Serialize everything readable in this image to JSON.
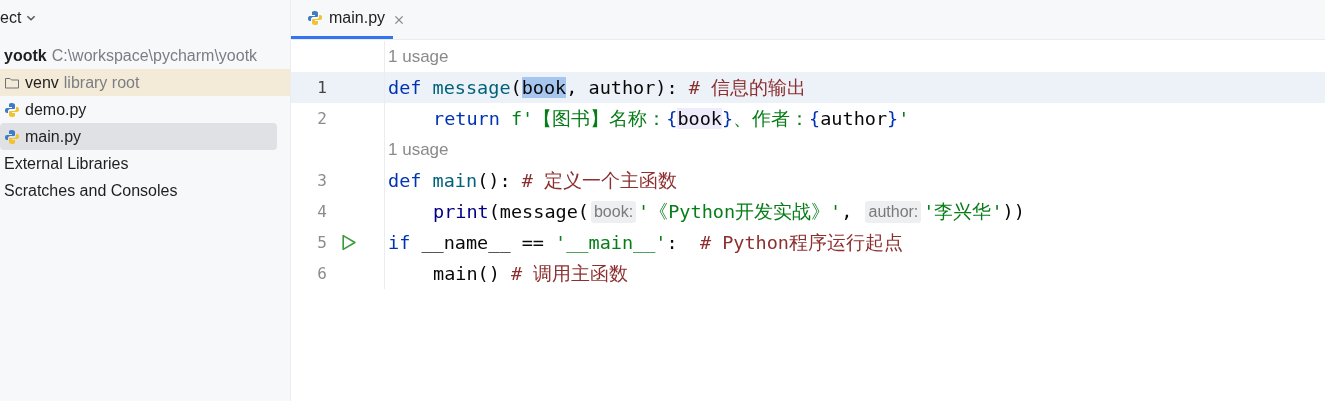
{
  "project_header": {
    "label": "ect"
  },
  "tabs": [
    {
      "label": "main.py",
      "selected": true
    }
  ],
  "project_tree": [
    {
      "label": "yootk",
      "detail": "C:\\workspace\\pycharm\\yootk",
      "kind": "module",
      "selected": false,
      "children": [
        {
          "label": "venv",
          "detail": "library root",
          "kind": "folder",
          "selected": false
        },
        {
          "label": "demo.py",
          "kind": "python",
          "selected": false
        },
        {
          "label": "main.py",
          "kind": "python",
          "selected": true
        }
      ]
    },
    {
      "label": "External Libraries",
      "kind": "plain",
      "selected": false
    },
    {
      "label": "Scratches and Consoles",
      "kind": "plain",
      "selected": false
    }
  ],
  "editor": {
    "lines": [
      {
        "kind": "usage",
        "text": "1 usage"
      },
      {
        "kind": "code",
        "number": "1",
        "current": true,
        "tokens": [
          {
            "kind": "keyword",
            "text": "def "
          },
          {
            "kind": "function",
            "text": "message"
          },
          {
            "kind": "plain",
            "text": "("
          },
          {
            "kind": "selection",
            "text": "book"
          },
          {
            "kind": "plain",
            "text": ", author): "
          },
          {
            "kind": "comment",
            "text": "# 信息的输出"
          }
        ]
      },
      {
        "kind": "code",
        "number": "2",
        "current": false,
        "indented": true,
        "tokens": [
          {
            "kind": "keyword",
            "text": "return "
          },
          {
            "kind": "string",
            "text": "f'【图书】名称："
          },
          {
            "kind": "keyword",
            "text": "{"
          },
          {
            "kind": "reference",
            "text": "book"
          },
          {
            "kind": "keyword",
            "text": "}"
          },
          {
            "kind": "string",
            "text": "、作者："
          },
          {
            "kind": "keyword",
            "text": "{"
          },
          {
            "kind": "plain",
            "text": "author"
          },
          {
            "kind": "keyword",
            "text": "}"
          },
          {
            "kind": "string",
            "text": "'"
          }
        ]
      },
      {
        "kind": "usage",
        "text": "1 usage"
      },
      {
        "kind": "code",
        "number": "3",
        "current": false,
        "tokens": [
          {
            "kind": "keyword",
            "text": "def "
          },
          {
            "kind": "function",
            "text": "main"
          },
          {
            "kind": "plain",
            "text": "(): "
          },
          {
            "kind": "comment",
            "text": "# 定义一个主函数"
          }
        ]
      },
      {
        "kind": "code",
        "number": "4",
        "current": false,
        "indented": true,
        "tokens": [
          {
            "kind": "builtin",
            "text": "print"
          },
          {
            "kind": "plain",
            "text": "(message("
          },
          {
            "kind": "hint",
            "text": "book:"
          },
          {
            "kind": "string",
            "text": "'《Python开发实战》'"
          },
          {
            "kind": "plain",
            "text": ", "
          },
          {
            "kind": "hint",
            "text": "author:"
          },
          {
            "kind": "string",
            "text": "'李兴华'"
          },
          {
            "kind": "plain",
            "text": "))"
          }
        ]
      },
      {
        "kind": "code",
        "number": "5",
        "current": false,
        "runnable": true,
        "tokens": [
          {
            "kind": "keyword",
            "text": "if "
          },
          {
            "kind": "plain",
            "text": "__name__ == "
          },
          {
            "kind": "string",
            "text": "'__main__'"
          },
          {
            "kind": "plain",
            "text": ":  "
          },
          {
            "kind": "comment",
            "text": "# Python程序运行起点"
          }
        ]
      },
      {
        "kind": "code",
        "number": "6",
        "current": false,
        "indented": true,
        "tokens": [
          {
            "kind": "plain",
            "text": "main() "
          },
          {
            "kind": "comment",
            "text": "# 调用主函数"
          }
        ]
      }
    ]
  }
}
